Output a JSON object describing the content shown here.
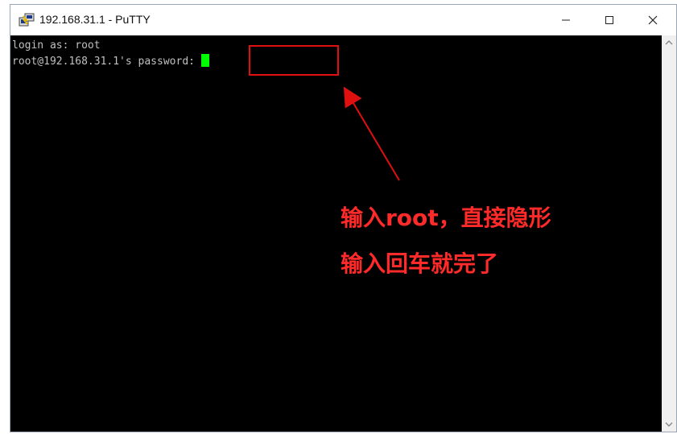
{
  "window": {
    "title": "192.168.31.1 - PuTTY",
    "minimize_icon": "minimize-icon",
    "maximize_icon": "maximize-icon",
    "close_icon": "close-icon",
    "app_icon": "putty-icon"
  },
  "terminal": {
    "line1": "login as: root",
    "line2_prompt": "root@192.168.31.1's password:",
    "cursor_color": "#00ff00",
    "background": "#000000",
    "text_color": "#c0c0c0"
  },
  "annotation": {
    "line1": "输入root，直接隐形",
    "line2": "输入回车就完了",
    "color": "#ff2a2a"
  },
  "scrollbar": {
    "up_icon": "chevron-up-icon",
    "down_icon": "chevron-down-icon"
  }
}
